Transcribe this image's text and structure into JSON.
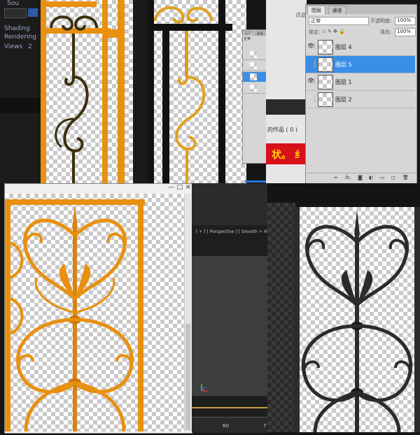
{
  "left_panel": {
    "lines": [
      "Sou",
      "Shading",
      "Rendering",
      "Views",
      "2"
    ]
  },
  "mid_text": {
    "snippet": "点此",
    "work_count": "的作品 ( 0 )",
    "banner": "状。 纟"
  },
  "viewport": {
    "label": "[ + ] [ Perspective ] [ Smooth + Highlights ]"
  },
  "ruler": {
    "tick_label": "60",
    "tick_label_2": "7"
  },
  "mini_panel": {
    "tab1": "图层",
    "tab2": "通道",
    "mode": "正常"
  },
  "layers_panel": {
    "tab_layers": "图层",
    "tab_channels": "通道",
    "blend_mode": "正常",
    "opacity_label": "不透明度:",
    "opacity_value": "100%",
    "lock_label": "锁定:",
    "fill_label": "填充:",
    "fill_value": "100%",
    "layers": [
      {
        "name": "图层 4",
        "visible": true,
        "selected": false
      },
      {
        "name": "图层 5",
        "visible": false,
        "selected": true
      },
      {
        "name": "图层 1",
        "visible": true,
        "selected": false
      },
      {
        "name": "图层 2",
        "visible": false,
        "selected": false
      }
    ],
    "footer_icons": [
      "link-icon",
      "fx-icon",
      "mask-icon",
      "adjustment-icon",
      "folder-icon",
      "new-layer-icon",
      "trash-icon"
    ]
  },
  "doc_window": {
    "min": "—",
    "max": "□",
    "close": "×"
  },
  "colors": {
    "orange": "#e8900f",
    "dark_iron": "#2b2b2b",
    "panel_bg": "#d6d6d6",
    "select_blue": "#3a8ee6"
  }
}
